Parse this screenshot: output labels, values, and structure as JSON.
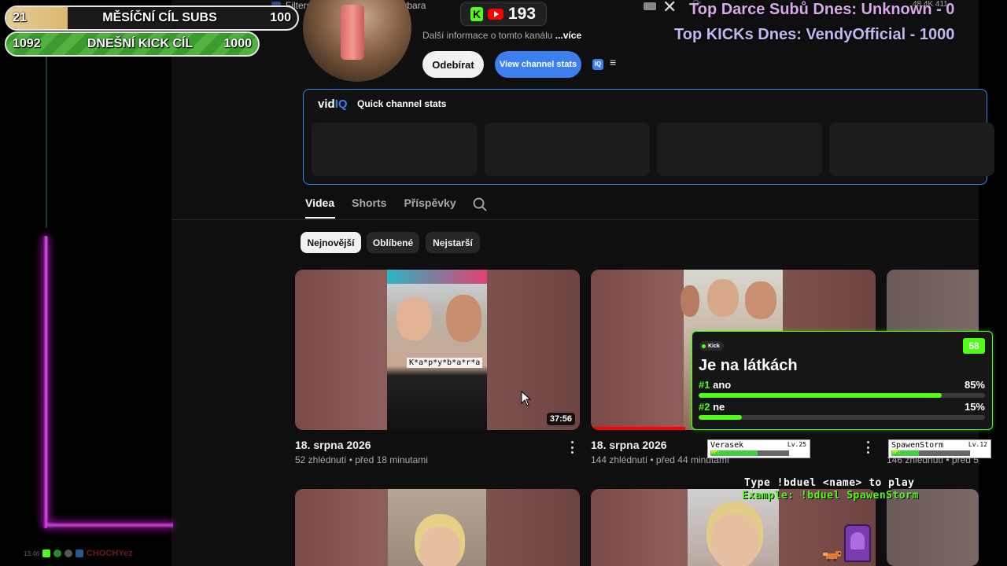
{
  "goals": {
    "subs": {
      "current": "21",
      "title": "MĚSÍČNÍ CÍL SUBS",
      "target": "100",
      "progress": 0.21
    },
    "kick": {
      "current": "1092",
      "title": "DNEŠNÍ KICK CÍL",
      "target": "1000",
      "progress": 1.0
    }
  },
  "top_bar": {
    "filters_label": "Filters",
    "kapybara_label": "kapybara",
    "viewer_count": "193",
    "mini_stats": "48.4K  411"
  },
  "overlay": {
    "top_dance": "Top Darce Subů Dnes: Unknown - 0",
    "top_kicks": "Top KICKs Dnes: VendyOfficial - 1000"
  },
  "channel": {
    "more_info": "Další informace o tomto kanálu",
    "more_link": "...více",
    "subscribe_label": "Odebírat",
    "stats_button_label": "View channel stats",
    "iq_badge": "IQ"
  },
  "vidiq": {
    "logo_prefix": "vid",
    "logo_suffix": "IQ",
    "title": "Quick channel stats"
  },
  "tabs": [
    "Videa",
    "Shorts",
    "Příspěvky"
  ],
  "chips": [
    "Nejnovější",
    "Oblíbené",
    "Nejstarší"
  ],
  "videos": [
    {
      "title": "18. srpna 2026",
      "meta": "52 zhlédnutí • před 18 minutami",
      "duration": "37:56",
      "caption": "K*a*p*y*b*a*r*a"
    },
    {
      "title": "18. srpna 2026",
      "meta": "144 zhlédnutí • před 44 minutami"
    },
    {
      "meta": "146 zhlédnutí • před 5"
    }
  ],
  "poll": {
    "badge": "Kick",
    "timer": "58",
    "question": "Je na látkách",
    "options": [
      {
        "num": "#1",
        "label": "ano",
        "pct": "85%",
        "value": 0.85
      },
      {
        "num": "#2",
        "label": "ne",
        "pct": "15%",
        "value": 0.15
      }
    ]
  },
  "duel": {
    "players": [
      {
        "name": "Verasek",
        "level": "Lv.25",
        "hp_label": "HP:",
        "hp": 0.6
      },
      {
        "name": "SpawenStorm",
        "level": "Lv.12",
        "hp_label": "HP:",
        "hp": 0.35
      }
    ],
    "help_line_1": "Type !bduel <name> to play",
    "help_line_2": "Example: !bduel SpawenStorm"
  },
  "chat": {
    "time": "13:46",
    "username": "CHOCHYez"
  },
  "colors": {
    "kick_green": "#53fc18",
    "youtube_red": "#ff0000",
    "vidiq_blue": "#3e7fef",
    "chat_glow": "#c020d0"
  }
}
